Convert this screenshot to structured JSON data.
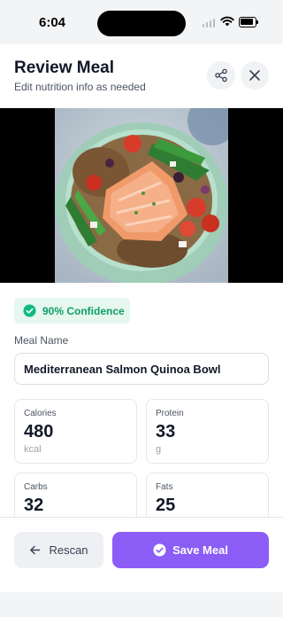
{
  "status_bar": {
    "time": "6:04"
  },
  "header": {
    "title": "Review Meal",
    "subtitle": "Edit nutrition info as needed",
    "share_icon": "share-icon",
    "close_icon": "close-icon"
  },
  "photo": {
    "description_icon": "meal-photo"
  },
  "confidence": {
    "label": "90% Confidence",
    "color": "#0f9d6b"
  },
  "meal_name": {
    "label": "Meal Name",
    "value": "Mediterranean Salmon Quinoa Bowl"
  },
  "stats": {
    "calories": {
      "label": "Calories",
      "value": "480",
      "unit": "kcal"
    },
    "protein": {
      "label": "Protein",
      "value": "33",
      "unit": "g"
    },
    "carbs": {
      "label": "Carbs",
      "value": "32"
    },
    "fats": {
      "label": "Fats",
      "value": "25"
    }
  },
  "footer": {
    "rescan_label": "Rescan",
    "save_label": "Save Meal",
    "accent": "#8b5cf6"
  }
}
